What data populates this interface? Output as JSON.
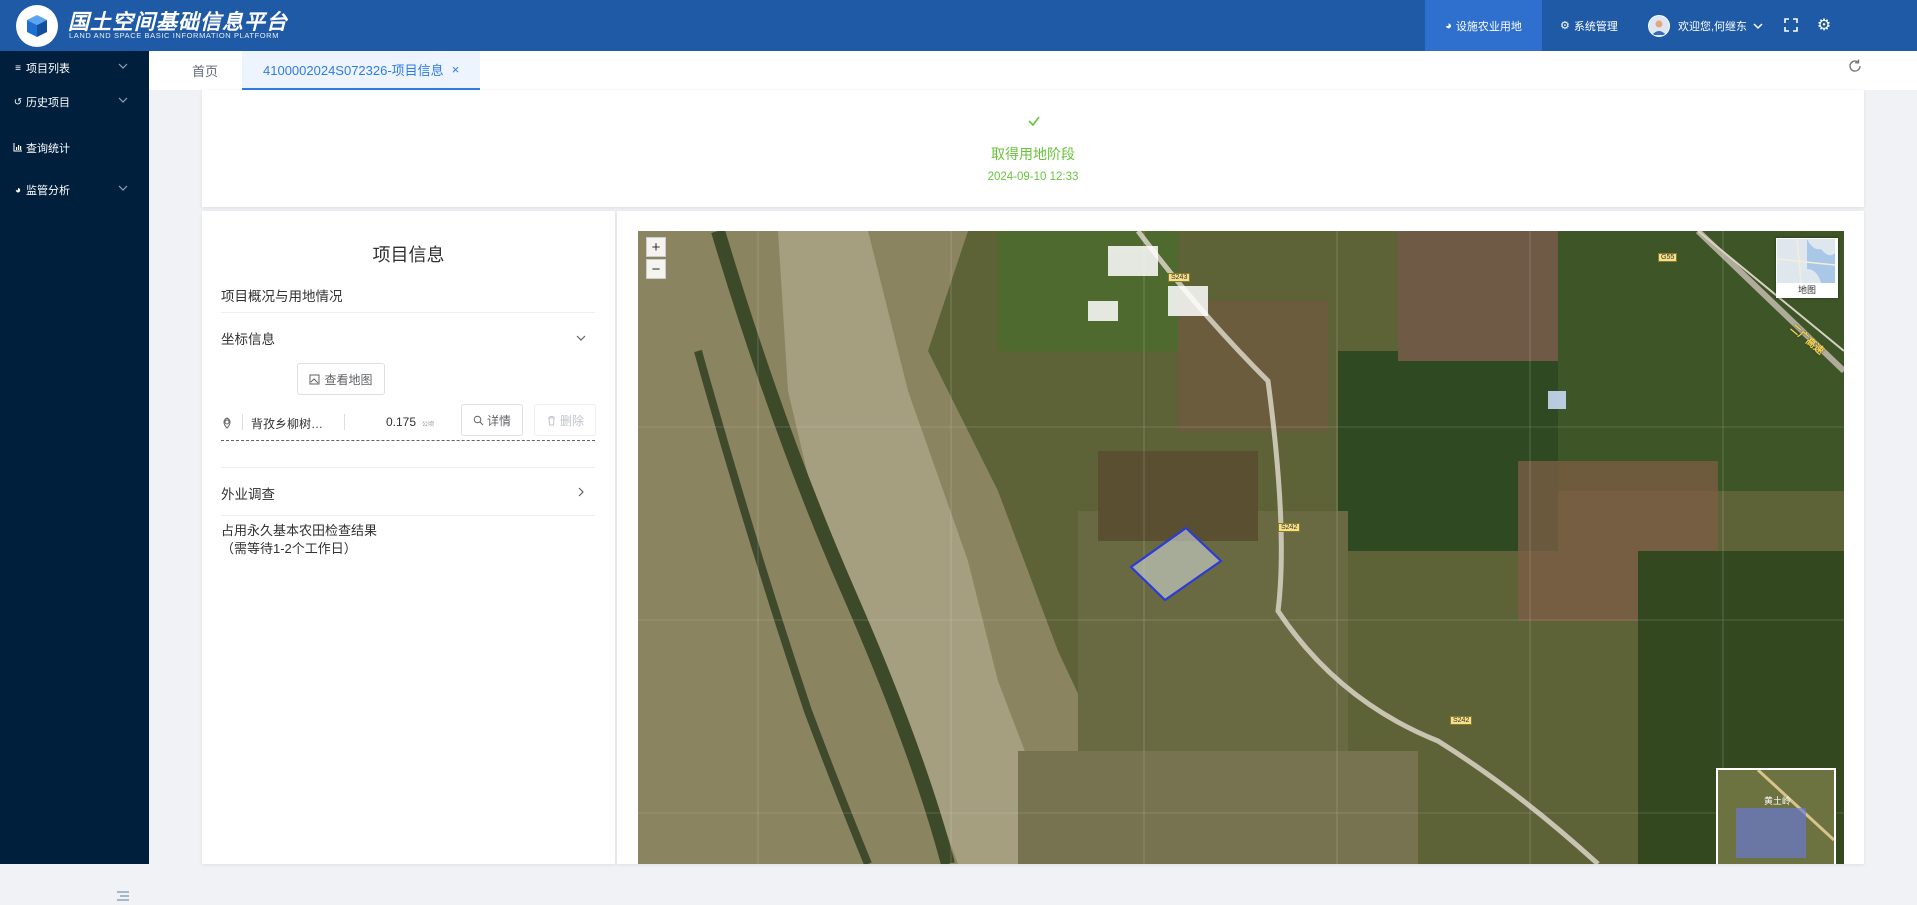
{
  "header": {
    "title": "国土空间基础信息平台",
    "subtitle": "LAND AND SPACE BASIC INFORMATION PLATFORM",
    "nav": [
      {
        "label": "设施农业用地",
        "icon": "pie-chart-icon",
        "active": true
      },
      {
        "label": "系统管理",
        "icon": "gears-icon",
        "active": false
      }
    ],
    "user_greeting": "欢迎您,何继东"
  },
  "sidebar": {
    "items": [
      {
        "label": "项目列表",
        "icon": "list-icon",
        "expandable": true
      },
      {
        "label": "历史项目",
        "icon": "history-icon",
        "expandable": true
      },
      {
        "label": "查询统计",
        "icon": "bar-chart-icon",
        "expandable": false
      },
      {
        "label": "监管分析",
        "icon": "pie-chart-icon",
        "expandable": true
      }
    ]
  },
  "tabs": [
    {
      "label": "首页",
      "active": false
    },
    {
      "label": "4100002024S072326-项目信息",
      "active": true,
      "close": "×"
    }
  ],
  "stage": {
    "title": "取得用地阶段",
    "time": "2024-09-10 12:33"
  },
  "project_panel": {
    "title": "项目信息",
    "overview_label": "项目概况与用地情况",
    "coord_section_label": "坐标信息",
    "view_map_button": "查看地图",
    "coord_item": {
      "name": "背孜乡柳树…",
      "area": "0.175",
      "unit": "公顷",
      "detail_button": "详情",
      "delete_button": "删除"
    },
    "field_survey_label": "外业调查",
    "farmland_check_line1": "占用永久基本农田检查结果",
    "farmland_check_line2": "（需等待1-2个工作日）"
  },
  "map": {
    "zoom_in": "+",
    "zoom_out": "−",
    "basemap_label": "地图",
    "road_labels": [
      "S243",
      "S242",
      "S242",
      "G55"
    ],
    "highway_label": "二广高速",
    "overview_label": "黄土岭"
  },
  "colors": {
    "header_bg": "#1f5aa6",
    "sidebar_bg": "#001f3d",
    "accent": "#2f7ae5",
    "success": "#67c23a",
    "parcel_stroke": "#2b3bd8"
  }
}
